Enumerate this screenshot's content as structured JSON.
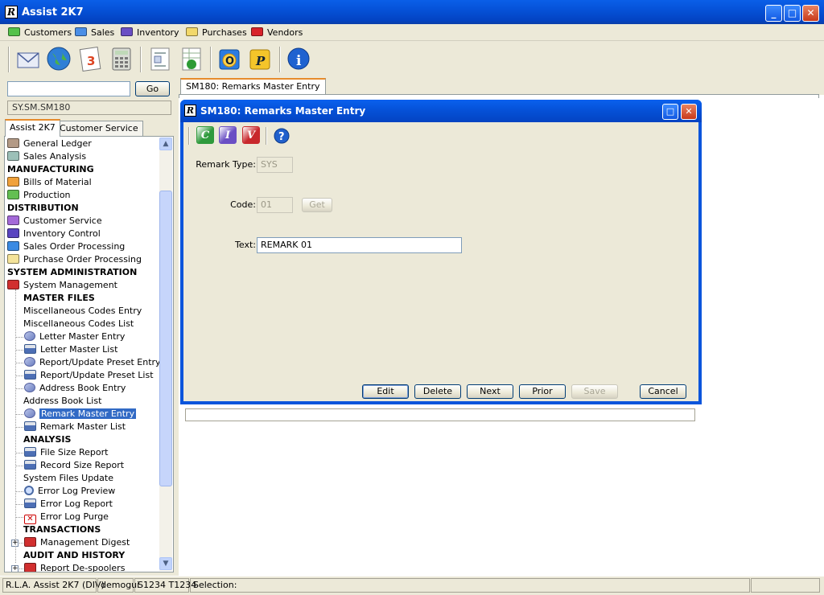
{
  "window": {
    "title": "Assist 2K7",
    "logo_text": "R"
  },
  "menubar": [
    {
      "label": "Customers",
      "color": "#54c24a"
    },
    {
      "label": "Sales",
      "color": "#4a8ee6"
    },
    {
      "label": "Inventory",
      "color": "#6a4fc4"
    },
    {
      "label": "Purchases",
      "color": "#f2d86a"
    },
    {
      "label": "Vendors",
      "color": "#d8232a"
    }
  ],
  "toolbar_icons": [
    "envelope-icon",
    "globe-icon",
    "calendar-icon",
    "calculator-icon",
    "form-icon",
    "spreadsheet-icon",
    "outlook-icon",
    "publisher-icon",
    "info-icon"
  ],
  "left": {
    "search_value": "",
    "go_label": "Go",
    "path": "SY.SM.SM180",
    "tabs": [
      "Assist 2K7",
      "Customer Service"
    ],
    "tree": [
      {
        "label": "General Ledger",
        "icon": "folder",
        "color": "#b39a86",
        "indent": 0
      },
      {
        "label": "Sales Analysis",
        "icon": "folder",
        "color": "#9cc0b8",
        "indent": 0
      },
      {
        "label": "MANUFACTURING",
        "hdr": true,
        "indent": -1
      },
      {
        "label": "Bills of Material",
        "icon": "folder",
        "color": "#f0a13a",
        "indent": 0
      },
      {
        "label": "Production",
        "icon": "folder",
        "color": "#63bf52",
        "indent": 0
      },
      {
        "label": "DISTRIBUTION",
        "hdr": true,
        "indent": -1
      },
      {
        "label": "Customer Service",
        "icon": "folder",
        "color": "#a46ad8",
        "indent": 0
      },
      {
        "label": "Inventory Control",
        "icon": "folder",
        "color": "#5a45c0",
        "indent": 0
      },
      {
        "label": "Sales Order Processing",
        "icon": "folder",
        "color": "#3a8ae3",
        "indent": 0
      },
      {
        "label": "Purchase Order Processing",
        "icon": "folder",
        "color": "#f4e39a",
        "indent": 0
      },
      {
        "label": "SYSTEM ADMINISTRATION",
        "hdr": true,
        "indent": -1
      },
      {
        "label": "System Management",
        "icon": "folder",
        "color": "#d12f2f",
        "indent": 0
      },
      {
        "label": "MASTER FILES",
        "hdr": true,
        "indent": 1
      },
      {
        "label": "Miscellaneous Codes Entry",
        "icon": "none",
        "indent": 1
      },
      {
        "label": "Miscellaneous Codes List",
        "icon": "none",
        "indent": 1
      },
      {
        "label": "Letter Master Entry",
        "icon": "screen",
        "indent": 2
      },
      {
        "label": "Letter Master List",
        "icon": "printer",
        "indent": 2
      },
      {
        "label": "Report/Update Preset Entry",
        "icon": "screen",
        "indent": 2
      },
      {
        "label": "Report/Update Preset List",
        "icon": "printer",
        "indent": 2
      },
      {
        "label": "Address Book Entry",
        "icon": "screen",
        "indent": 2
      },
      {
        "label": "Address Book List",
        "icon": "none",
        "indent": 1
      },
      {
        "label": "Remark Master Entry",
        "icon": "screen",
        "indent": 2,
        "selected": true
      },
      {
        "label": "Remark Master List",
        "icon": "printer",
        "indent": 2
      },
      {
        "label": "ANALYSIS",
        "hdr": true,
        "indent": 1
      },
      {
        "label": "File Size Report",
        "icon": "printer",
        "indent": 2
      },
      {
        "label": "Record Size Report",
        "icon": "printer",
        "indent": 2
      },
      {
        "label": "System Files Update",
        "icon": "none",
        "indent": 1
      },
      {
        "label": "Error Log Preview",
        "icon": "magnifier",
        "indent": 2
      },
      {
        "label": "Error Log Report",
        "icon": "printer",
        "indent": 2
      },
      {
        "label": "Error Log Purge",
        "icon": "x",
        "indent": 2
      },
      {
        "label": "TRANSACTIONS",
        "hdr": true,
        "indent": 1
      },
      {
        "label": "Management Digest",
        "icon": "folder",
        "color": "#d12f2f",
        "indent": 2,
        "expander": true
      },
      {
        "label": "AUDIT AND HISTORY",
        "hdr": true,
        "indent": 1
      },
      {
        "label": "Report De-spoolers",
        "icon": "folder",
        "color": "#d12f2f",
        "indent": 2,
        "expander": true
      }
    ]
  },
  "right": {
    "tab_label": "SM180: Remarks Master Entry"
  },
  "dialog": {
    "title": "SM180: Remarks Master Entry",
    "icons": [
      {
        "letter": "C",
        "color": "#2f9a3c",
        "name": "c-icon"
      },
      {
        "letter": "I",
        "color": "#6a4fc4",
        "name": "i-icon"
      },
      {
        "letter": "V",
        "color": "#c8282c",
        "name": "v-icon"
      }
    ],
    "fields": {
      "remark_type": {
        "label": "Remark Type:",
        "value": "SYS"
      },
      "code": {
        "label": "Code:",
        "value": "01"
      },
      "text": {
        "label": "Text:",
        "value": "REMARK 01"
      }
    },
    "get_label": "Get",
    "buttons": {
      "edit": "Edit",
      "delete": "Delete",
      "next": "Next",
      "prior": "Prior",
      "save": "Save",
      "cancel": "Cancel"
    }
  },
  "status": {
    "app": "R.L.A. Assist 2K7 (DIV)",
    "user": "demogui",
    "terminal": "S1234 T1234",
    "selection": "Selection:"
  }
}
